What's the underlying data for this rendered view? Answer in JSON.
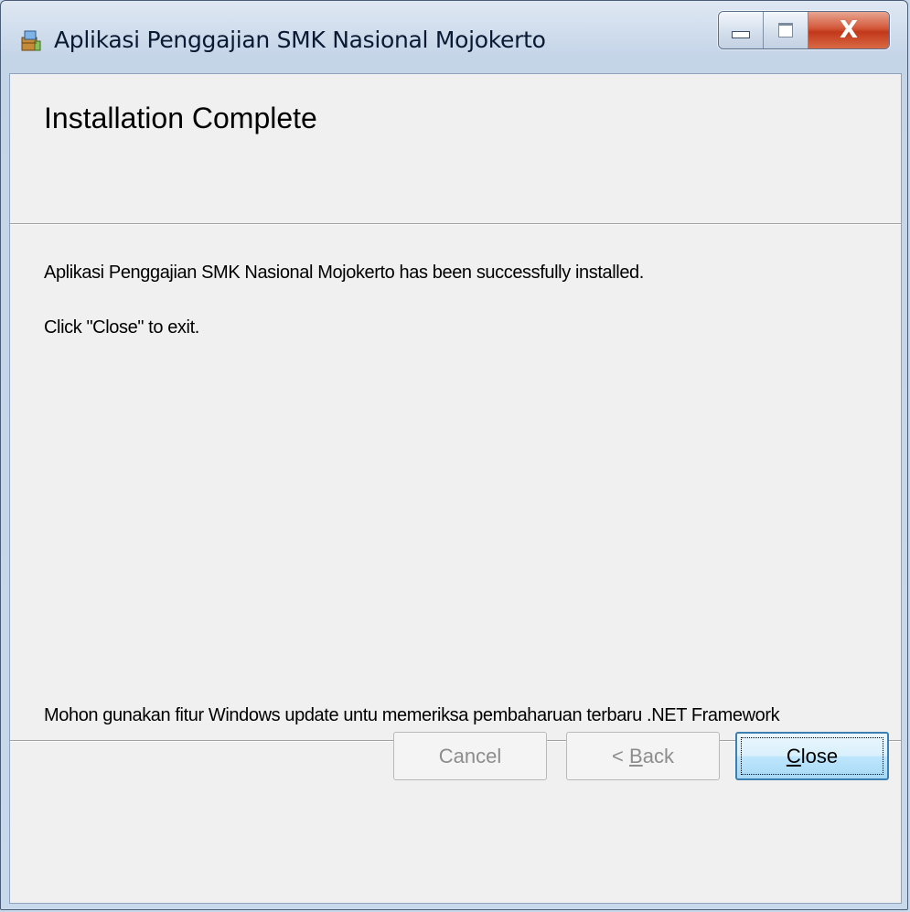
{
  "window": {
    "title": "Aplikasi Penggajian SMK Nasional Mojokerto",
    "close_glyph": "X"
  },
  "header": {
    "title": "Installation Complete"
  },
  "body": {
    "line1": "Aplikasi Penggajian SMK Nasional Mojokerto has been successfully installed.",
    "line2": "Click \"Close\" to exit.",
    "note": "Mohon gunakan fitur Windows update untu memeriksa pembaharuan terbaru .NET Framework"
  },
  "buttons": {
    "cancel": "Cancel",
    "back_prefix": "< ",
    "back_mnemonic": "B",
    "back_rest": "ack",
    "close_mnemonic": "C",
    "close_rest": "lose"
  },
  "colors": {
    "close_button": "#c2381a",
    "primary_button_border": "#3c7fb1"
  }
}
